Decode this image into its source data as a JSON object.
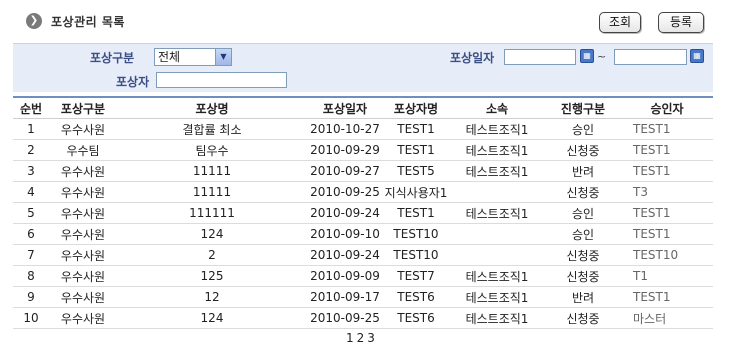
{
  "header": {
    "title": "포상관리 목록",
    "title_icon": "circle-arrow-icon",
    "search_label": "조회",
    "register_label": "등록"
  },
  "filter": {
    "category_label": "포상구분",
    "category_value": "전체",
    "date_label": "포상일자",
    "date_from": "",
    "date_to": "",
    "range_separator": "~",
    "awardee_label": "포상자",
    "awardee_value": ""
  },
  "table": {
    "columns": [
      "순번",
      "포상구분",
      "포상명",
      "포상일자",
      "포상자명",
      "소속",
      "진행구분",
      "승인자"
    ],
    "rows": [
      [
        "1",
        "우수사원",
        "결합률 최소",
        "2010-10-27",
        "TEST1",
        "테스트조직1",
        "승인",
        "TEST1"
      ],
      [
        "2",
        "우수팀",
        "팀우수",
        "2010-09-29",
        "TEST1",
        "테스트조직1",
        "신청중",
        "TEST1"
      ],
      [
        "3",
        "우수사원",
        "11111",
        "2010-09-27",
        "TEST5",
        "테스트조직1",
        "반려",
        "TEST1"
      ],
      [
        "4",
        "우수사원",
        "11111",
        "2010-09-25",
        "지식사용자1",
        "",
        "신청중",
        "T3"
      ],
      [
        "5",
        "우수사원",
        "111111",
        "2010-09-24",
        "TEST1",
        "테스트조직1",
        "승인",
        "TEST1"
      ],
      [
        "6",
        "우수사원",
        "124",
        "2010-09-10",
        "TEST10",
        "",
        "승인",
        "TEST1"
      ],
      [
        "7",
        "우수사원",
        "2",
        "2010-09-24",
        "TEST10",
        "",
        "신청중",
        "TEST10"
      ],
      [
        "8",
        "우수사원",
        "125",
        "2010-09-09",
        "TEST7",
        "테스트조직1",
        "신청중",
        "T1"
      ],
      [
        "9",
        "우수사원",
        "12",
        "2010-09-17",
        "TEST6",
        "테스트조직1",
        "반려",
        "TEST1"
      ],
      [
        "10",
        "우수사원",
        "124",
        "2010-09-25",
        "TEST6",
        "테스트조직1",
        "신청중",
        "마스터"
      ]
    ]
  },
  "pagination": {
    "pages": [
      "1",
      "2",
      "3"
    ]
  },
  "colors": {
    "filter_background": "#e7edf8",
    "label_color": "#3b4f86",
    "table_top_border": "#6f8fc0"
  }
}
